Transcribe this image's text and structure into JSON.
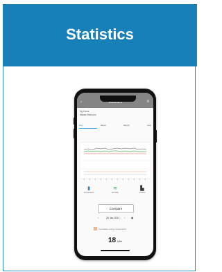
{
  "card": {
    "title": "Statistics"
  },
  "phone": {
    "appbar": {
      "back": "‹",
      "title": "Statistics",
      "menu": "≡"
    },
    "subtitle_line1": "My Home",
    "subtitle_line2": "Master Bedroom",
    "tabs": [
      {
        "label": "Day",
        "active": true
      },
      {
        "label": "Week",
        "active": false
      },
      {
        "label": "Month",
        "active": false
      },
      {
        "label": "Year",
        "active": false
      }
    ],
    "icons": [
      {
        "icon": "thermometer-icon",
        "glyph": "🌡",
        "label": "Temperature"
      },
      {
        "icon": "humidity-icon",
        "glyph": "≋",
        "label": "Humidity"
      },
      {
        "icon": "building-icon",
        "glyph": "▙",
        "label": "Outdoor"
      }
    ],
    "compare_label": "Compare",
    "date": "26 Jan 2021",
    "legend_text": "Cumulative energy consumption",
    "value": "18",
    "unit": "kWh",
    "chart": {
      "series_colors": [
        "#8a8a8a",
        "#5cb85c",
        "#d9534f",
        "#e8a27a"
      ]
    }
  }
}
